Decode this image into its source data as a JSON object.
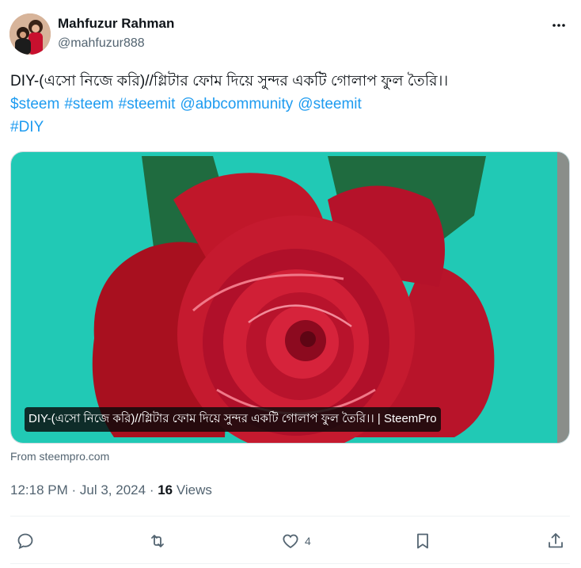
{
  "author": {
    "name": "Mahfuzur Rahman",
    "handle": "@mahfuzur888"
  },
  "post": {
    "text": "DIY-(এসো নিজে করি)//গ্লিটার ফোম দিয়ে সুন্দর একটি গোলাপ  ফুল তৈরি।।",
    "tags_line1": [
      "$steem",
      "#steem",
      "#steemit",
      "@abbcommunity",
      "@steemit"
    ],
    "tags_line2": [
      "#DIY"
    ]
  },
  "media": {
    "caption": "DIY-(এসো নিজে করি)//গ্লিটার ফোম দিয়ে সুন্দর একটি গোলাপ ফুল তৈরি।। | SteemPro",
    "source": "From steempro.com",
    "bg_color": "#21c9b5",
    "rose_color": "#c0172a",
    "leaf_color": "#1f6b3f"
  },
  "meta": {
    "time": "12:18 PM",
    "date": "Jul 3, 2024",
    "views_count": "16",
    "views_label": "Views"
  },
  "actions": {
    "likes": "4"
  },
  "colors": {
    "link": "#1d9bf0",
    "secondary": "#536471"
  }
}
